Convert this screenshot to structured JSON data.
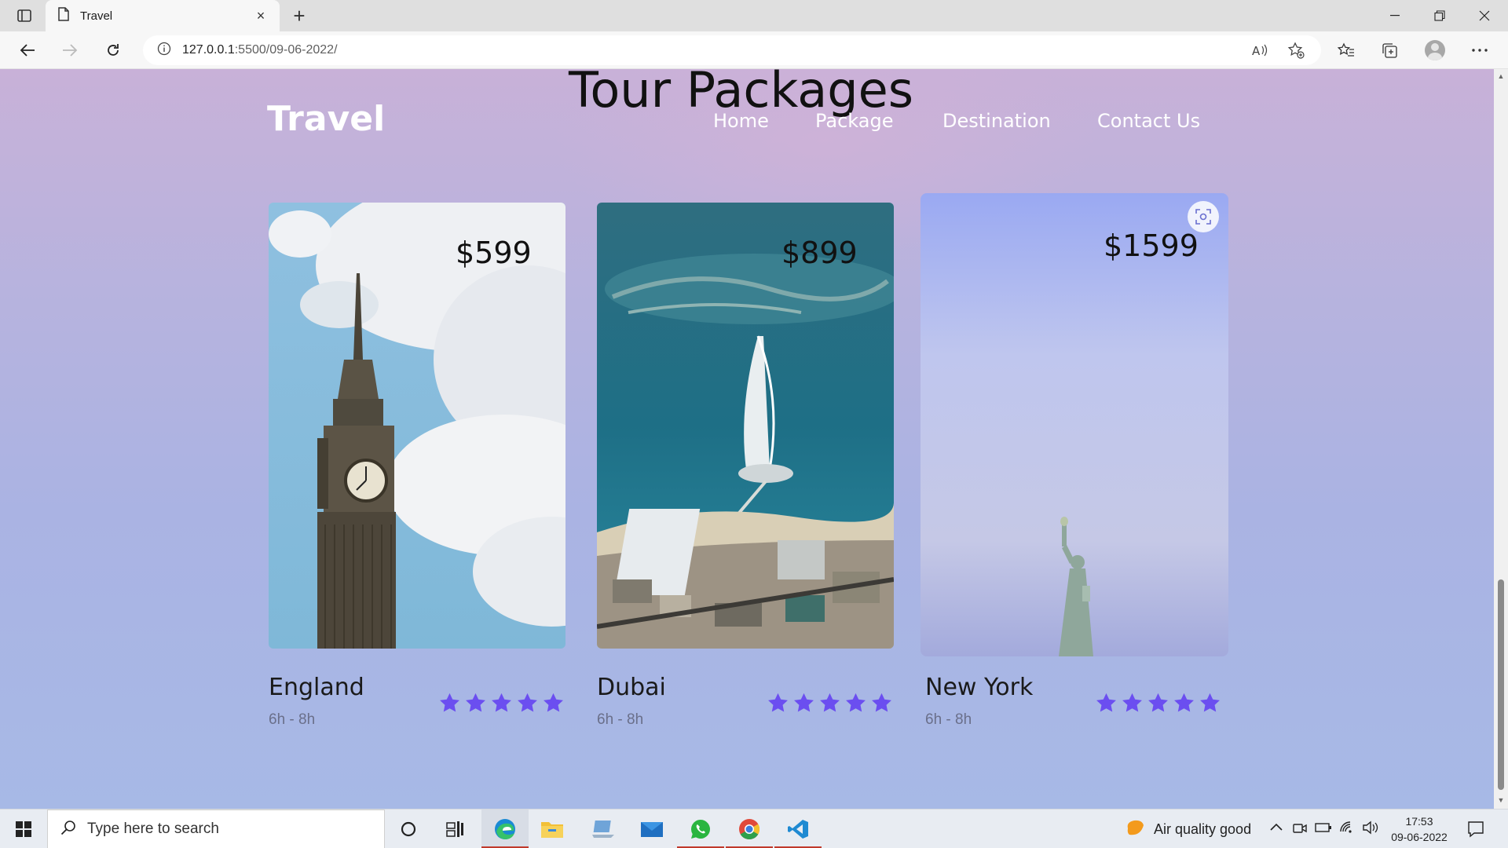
{
  "browser": {
    "tab_title": "Travel",
    "url_host": "127.0.0.1",
    "url_rest": ":5500/09-06-2022/"
  },
  "page": {
    "section_title": "Tour Packages",
    "logo": "Travel",
    "menu": [
      "Home",
      "Package",
      "Destination",
      "Contact Us"
    ],
    "packages": [
      {
        "name": "England",
        "price": "$599",
        "duration": "6h - 8h",
        "rating": 5
      },
      {
        "name": "Dubai",
        "price": "$899",
        "duration": "6h - 8h",
        "rating": 5
      },
      {
        "name": "New York",
        "price": "$1599",
        "duration": "6h - 8h",
        "rating": 5
      }
    ],
    "star_color": "#6b4ef0"
  },
  "taskbar": {
    "search_placeholder": "Type here to search",
    "weather": "Air quality good",
    "time": "17:53",
    "date": "09-06-2022",
    "apps": [
      "cortana-icon",
      "task-view-icon",
      "edge-icon",
      "file-explorer-icon",
      "laptop-app-icon",
      "mail-icon",
      "whatsapp-icon",
      "chrome-icon",
      "vscode-icon"
    ]
  }
}
